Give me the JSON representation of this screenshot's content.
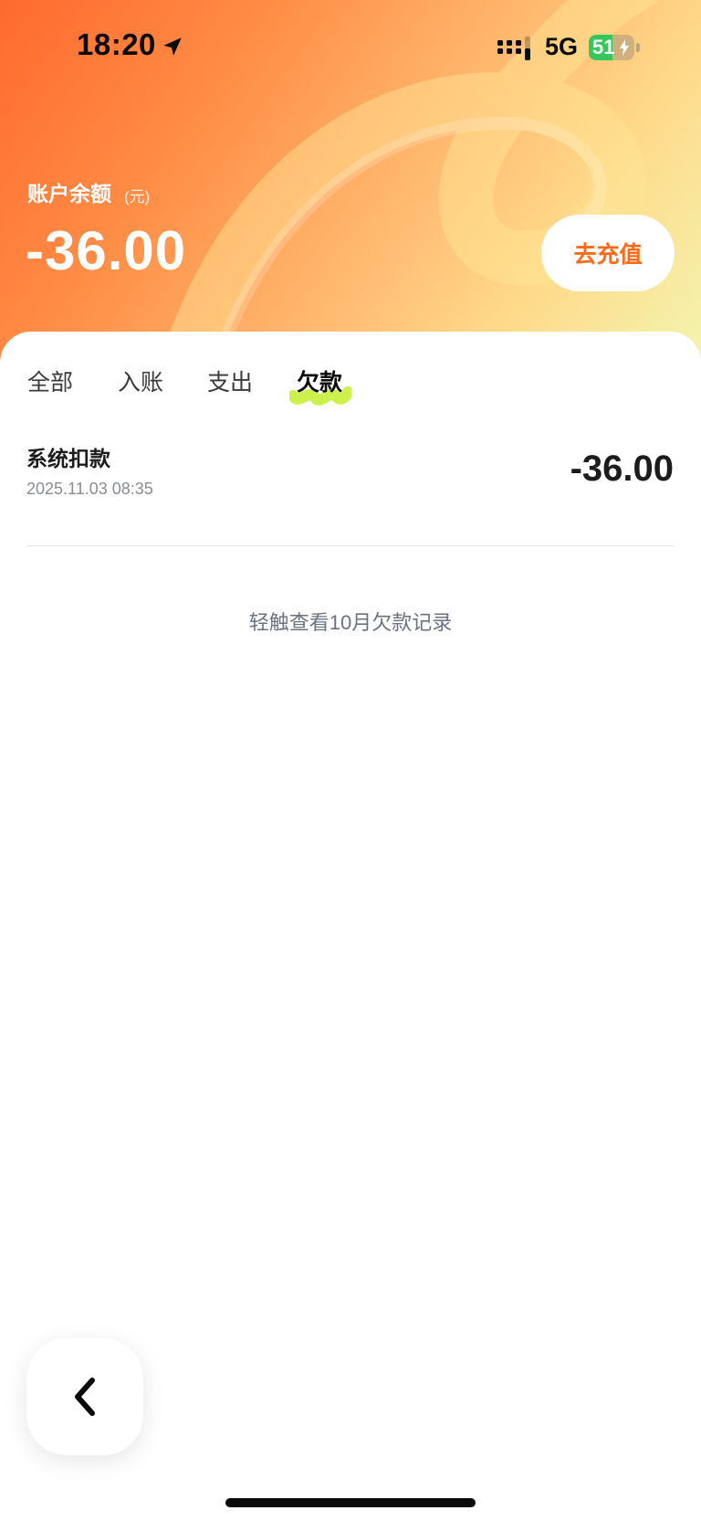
{
  "status_bar": {
    "time": "18:20",
    "network": "5G",
    "battery_level": 51,
    "battery_label": "51",
    "icons": [
      "location-arrow-icon",
      "signal-icon",
      "battery-charging-icon"
    ]
  },
  "header": {
    "balance_label": "账户余额",
    "balance_unit": "(元)",
    "balance_value": "-36.00",
    "recharge_label": "去充值"
  },
  "tabs": {
    "items": [
      {
        "label": "全部",
        "active": false
      },
      {
        "label": "入账",
        "active": false
      },
      {
        "label": "支出",
        "active": false
      },
      {
        "label": "欠款",
        "active": true
      }
    ]
  },
  "records": [
    {
      "title": "系统扣款",
      "time": "2025.11.03 08:35",
      "amount": "-36.00"
    }
  ],
  "history_link": "轻触查看10月欠款记录",
  "nav": {
    "back_icon": "chevron-left-icon"
  },
  "colors": {
    "accent": "#ff6a16",
    "tab_highlight": "#c6f03a",
    "battery": "#34c759"
  }
}
